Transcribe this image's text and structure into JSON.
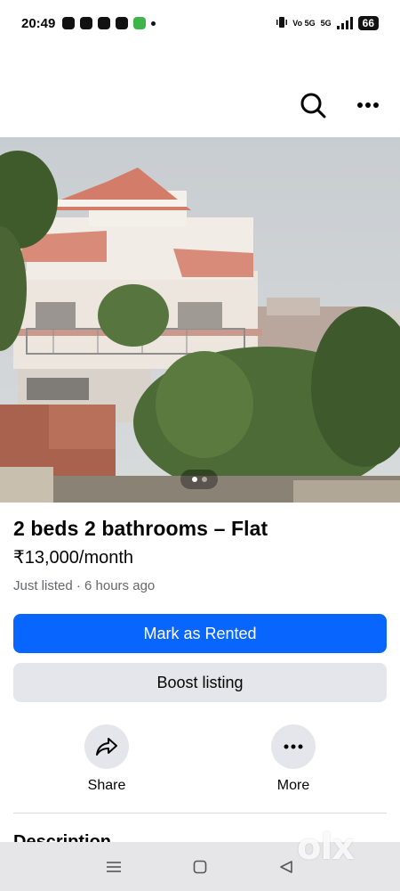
{
  "status_bar": {
    "time": "20:49",
    "network_label": "5G",
    "volte_label": "Vo 5G",
    "battery": "66"
  },
  "header": {
    "search_icon": "search-icon",
    "more_icon": "more-horizontal-icon"
  },
  "listing": {
    "photo_count": 2,
    "active_photo": 1,
    "title": "2 beds 2 bathrooms – Flat",
    "price": "₹13,000/month",
    "listed": "Just listed · 6 hours ago"
  },
  "buttons": {
    "mark_rented": "Mark as Rented",
    "boost": "Boost listing"
  },
  "actions": {
    "share": "Share",
    "more": "More"
  },
  "description": {
    "heading": "Description"
  },
  "watermark": "olx",
  "colors": {
    "primary": "#0866ff",
    "secondary_bg": "#e4e6eb",
    "muted_text": "#65676b"
  }
}
